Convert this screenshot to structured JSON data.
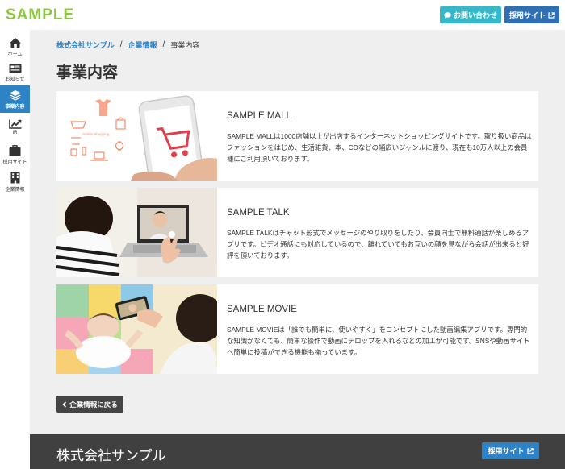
{
  "header": {
    "logo": "SAMPLE",
    "contact_label": "お問い合わせ",
    "recruit_label": "採用サイト"
  },
  "sidebar": {
    "items": [
      {
        "label": "ホーム",
        "icon": "home-icon"
      },
      {
        "label": "お知らせ",
        "icon": "news-icon"
      },
      {
        "label": "事業内容",
        "icon": "layers-icon"
      },
      {
        "label": "IR",
        "icon": "chart-icon"
      },
      {
        "label": "採用サイト",
        "icon": "briefcase-icon"
      },
      {
        "label": "企業情報",
        "icon": "building-icon"
      }
    ]
  },
  "breadcrumb": {
    "items": [
      "株式会社サンプル",
      "企業情報",
      "事業内容"
    ]
  },
  "page_title": "事業内容",
  "services": [
    {
      "title": "SAMPLE MALL",
      "description": "SAMPLE MALLは1000店舗以上が出店するインターネットショッピングサイトです。取り扱い商品はファッションをはじめ、生活雑貨、本、CDなどの幅広いジャンルに渡り、現在も10万人以上の会員様にご利用頂いております。",
      "image_text": "Online Shopping"
    },
    {
      "title": "SAMPLE TALK",
      "description": "SAMPLE TALKはチャット形式でメッセージのやり取りをしたり、会員同士で無料通話が楽しめるアプリです。ビデオ通話にも対応しているので、離れていてもお互いの顔を見ながら会話が出来ると好評を頂いております。"
    },
    {
      "title": "SAMPLE MOVIE",
      "description": "SAMPLE MOVIEは「誰でも簡単に、使いやすく」をコンセプトにした動画編集アプリです。専門的な知識がなくても、簡単な操作で動画にテロップを入れるなどの加工が可能です。SNSや動画サイトへ簡単に投稿ができる機能も揃っています。"
    }
  ],
  "back_label": "企業情報に戻る",
  "footer": {
    "company": "株式会社サンプル",
    "recruit_label": "採用サイト"
  },
  "colors": {
    "logo": "#8cc63f",
    "contact": "#36b8c8",
    "recruit": "#2f6fb2",
    "accent": "#2e82c6",
    "footer": "#404040"
  }
}
